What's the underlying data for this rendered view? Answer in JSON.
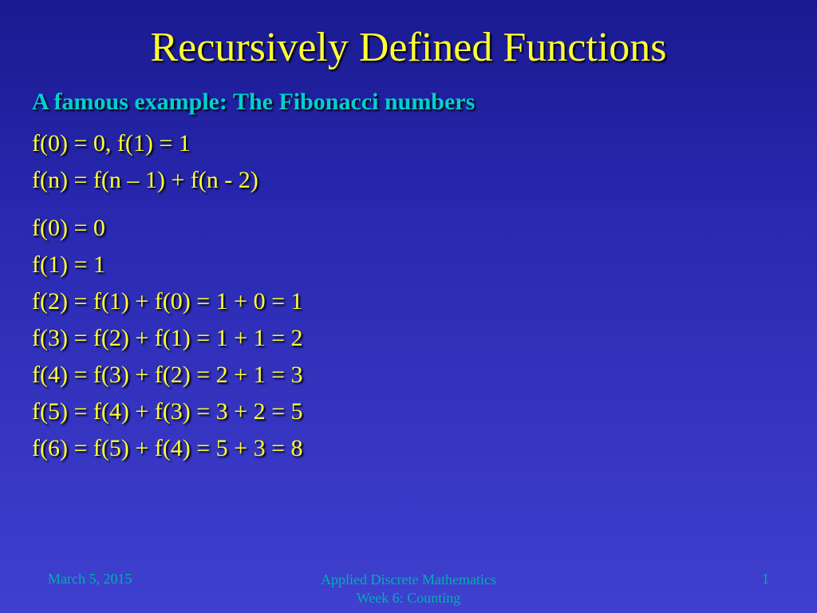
{
  "title": "Recursively Defined Functions",
  "subtitle": "A famous example: The Fibonacci numbers",
  "defs": {
    "base": "f(0) = 0, f(1) = 1",
    "recursive": "f(n) = f(n – 1) + f(n - 2)"
  },
  "sequence": [
    "f(0) = 0",
    "f(1) = 1",
    "f(2) = f(1) + f(0) = 1 + 0 = 1",
    "f(3) = f(2) + f(1) = 1 + 1 = 2",
    "f(4) = f(3) + f(2) = 2 + 1 = 3",
    "f(5) = f(4) + f(3) = 3 + 2 = 5",
    "f(6) = f(5) + f(4) = 5 + 3 = 8"
  ],
  "footer": {
    "date": "March 5, 2015",
    "course_line1": "Applied Discrete Mathematics",
    "course_line2": "Week 6: Counting",
    "page": "1"
  }
}
